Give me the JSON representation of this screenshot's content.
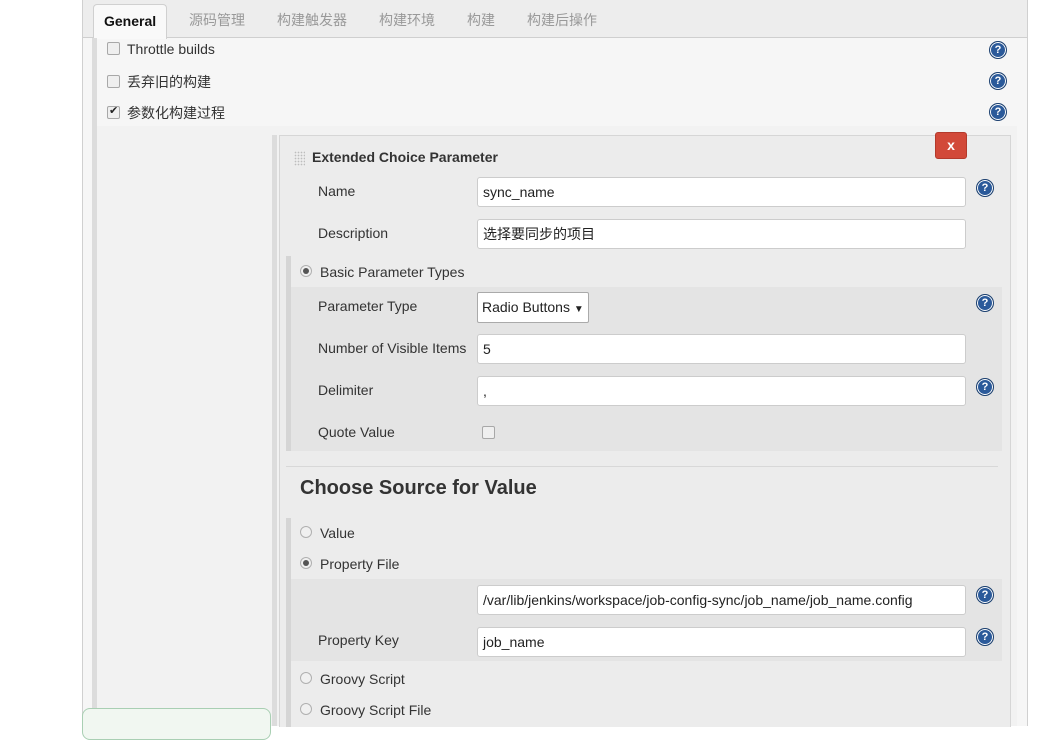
{
  "tabs": [
    {
      "label": "General",
      "active": true
    },
    {
      "label": "源码管理",
      "active": false
    },
    {
      "label": "构建触发器",
      "active": false
    },
    {
      "label": "构建环境",
      "active": false
    },
    {
      "label": "构建",
      "active": false
    },
    {
      "label": "构建后操作",
      "active": false
    }
  ],
  "general_options": [
    {
      "label": "Throttle builds",
      "checked": false
    },
    {
      "label": "丢弃旧的构建",
      "checked": false
    },
    {
      "label": "参数化构建过程",
      "checked": true
    }
  ],
  "parameter": {
    "title": "Extended Choice Parameter",
    "delete_label": "x",
    "name_label": "Name",
    "name_value": "sync_name",
    "description_label": "Description",
    "description_value": "选择要同步的项目",
    "basic_types_label": "Basic Parameter Types",
    "parameter_type_label": "Parameter Type",
    "parameter_type_value": "Radio Buttons",
    "visible_items_label": "Number of Visible Items",
    "visible_items_value": "5",
    "delimiter_label": "Delimiter",
    "delimiter_value": ",",
    "quote_value_label": "Quote Value",
    "quote_value_checked": false
  },
  "source": {
    "heading": "Choose Source for Value",
    "options": [
      {
        "label": "Value",
        "selected": false
      },
      {
        "label": "Property File",
        "selected": true
      },
      {
        "label": "Groovy Script",
        "selected": false
      },
      {
        "label": "Groovy Script File",
        "selected": false
      }
    ],
    "property_file_value": "/var/lib/jenkins/workspace/job-config-sync/job_name/job_name.config",
    "property_key_label": "Property Key",
    "property_key_value": "job_name"
  },
  "help_icon_glyph": "?"
}
